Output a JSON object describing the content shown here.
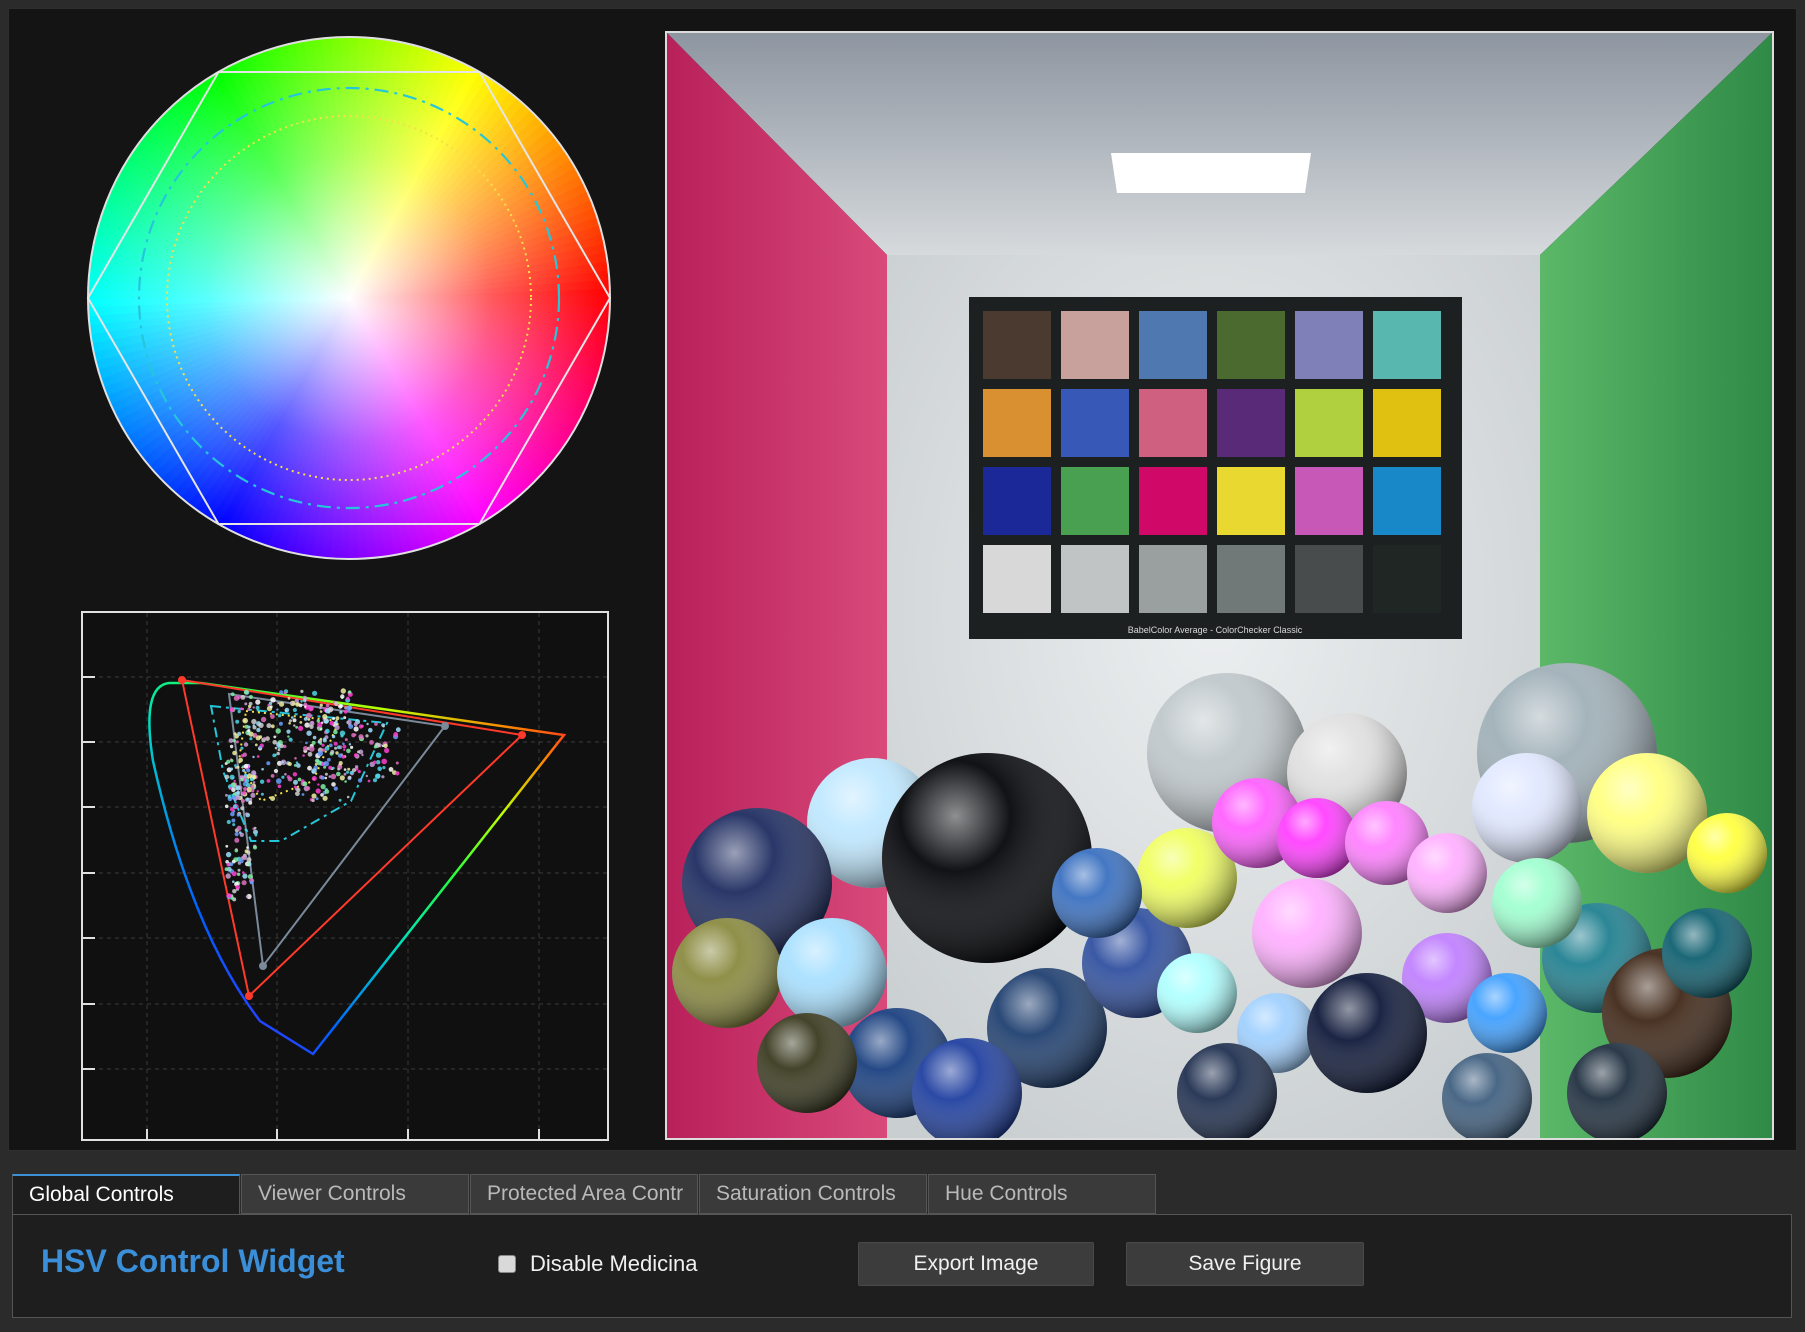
{
  "tabs": [
    {
      "label": "Global Controls",
      "active": true
    },
    {
      "label": "Viewer Controls",
      "active": false
    },
    {
      "label": "Protected Area Contr",
      "active": false
    },
    {
      "label": "Saturation Controls",
      "active": false
    },
    {
      "label": "Hue Controls",
      "active": false
    }
  ],
  "controls": {
    "title": "HSV Control Widget",
    "checkbox_label": "Disable Medicina",
    "checkbox_checked": false,
    "export_button": "Export Image",
    "save_button": "Save Figure"
  },
  "viewer": {
    "checker_caption": "BabelColor Average - ColorChecker Classic",
    "checker_swatches": [
      "#4a3a30",
      "#c8a09c",
      "#4f78b0",
      "#4a6a30",
      "#8080b8",
      "#58b8b0",
      "#d89030",
      "#3858b8",
      "#d06080",
      "#582a78",
      "#b0d040",
      "#e0c010",
      "#1a2898",
      "#48a050",
      "#d00868",
      "#e8d830",
      "#c858b8",
      "#1888c8",
      "#d8d8d8",
      "#c0c4c4",
      "#9aa0a0",
      "#707878",
      "#484c4c",
      "#202624"
    ]
  },
  "colors": {
    "accent": "#3a8fd8",
    "background": "#141414"
  }
}
